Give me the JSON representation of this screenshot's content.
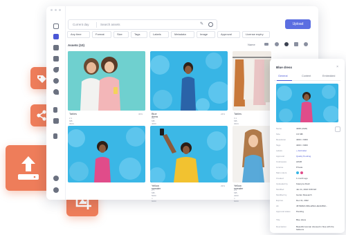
{
  "window": {
    "search_scope": "Current day",
    "search_placeholder": "Search assets",
    "upload_label": "Upload"
  },
  "filters": [
    "Any time",
    "Format",
    "Size",
    "Tags",
    "Labels",
    "Metadata",
    "Image",
    "Approval",
    "License expiry"
  ],
  "assets": {
    "title": "Assets (10)",
    "sort_label": "Name",
    "cards": [
      {
        "name": "Tables",
        "meta": "2.1 MB · 3024 × 4032",
        "pct": "30%"
      },
      {
        "name": "Blue dress",
        "meta": "3.6 MB · 4000 × 6000",
        "pct": "24%"
      },
      {
        "name": "Tables",
        "meta": "3.1 MB · 3024 × 4032",
        "pct": ""
      },
      {
        "name": "",
        "meta": "",
        "pct": ""
      },
      {
        "name": "Yellow sweater",
        "meta": "2.7 MB · 5000 × 6000",
        "pct": "29%"
      },
      {
        "name": "Yellow sweater",
        "meta": "2.6 MB · 4000 × 6000",
        "pct": ""
      }
    ]
  },
  "panel": {
    "title": "Blue dress",
    "tabs": [
      "General",
      "Content",
      "Embedded"
    ],
    "rows": [
      {
        "label": "Name",
        "value": "4008 (1920)"
      },
      {
        "label": "Size",
        "value": "3.6 MB"
      },
      {
        "label": "Resolution",
        "value": "4000 × 6000"
      },
      {
        "label": "Tags",
        "value": "4000 × 6000"
      },
      {
        "label": "Labels",
        "value": "+ Add label"
      },
      {
        "label": "Approval",
        "value": "Quality Pending"
      },
      {
        "label": "Colorspace",
        "value": "sRGB"
      },
      {
        "label": "License",
        "value": "Private"
      },
      {
        "label": "Main colors",
        "value": ""
      },
      {
        "label": "Created",
        "value": "1 month ago"
      },
      {
        "label": "Uploaded by",
        "value": "Kateryna Rosh"
      },
      {
        "label": "Modified",
        "value": "Jan 11, 2022 9:08 AM"
      },
      {
        "label": "Modified by",
        "value": "Gerian Research"
      },
      {
        "label": "Expires",
        "value": "Dec 31, 2022"
      },
      {
        "label": "Alt",
        "value": "4579082C.88A-E5FA-4E40-B93..."
      },
      {
        "label": "Approval status",
        "value": "Pending"
      },
      {
        "label": "Title",
        "value": "Blue dress"
      },
      {
        "label": "Description",
        "value": "Beautiful woman dressed in blue with the balloons"
      }
    ]
  },
  "colors": {
    "accent": "#5b6ee1",
    "tile_orange": "#ee7d5a",
    "teal_bg": "#6ccfd0",
    "blue_bg": "#39b6e6"
  }
}
